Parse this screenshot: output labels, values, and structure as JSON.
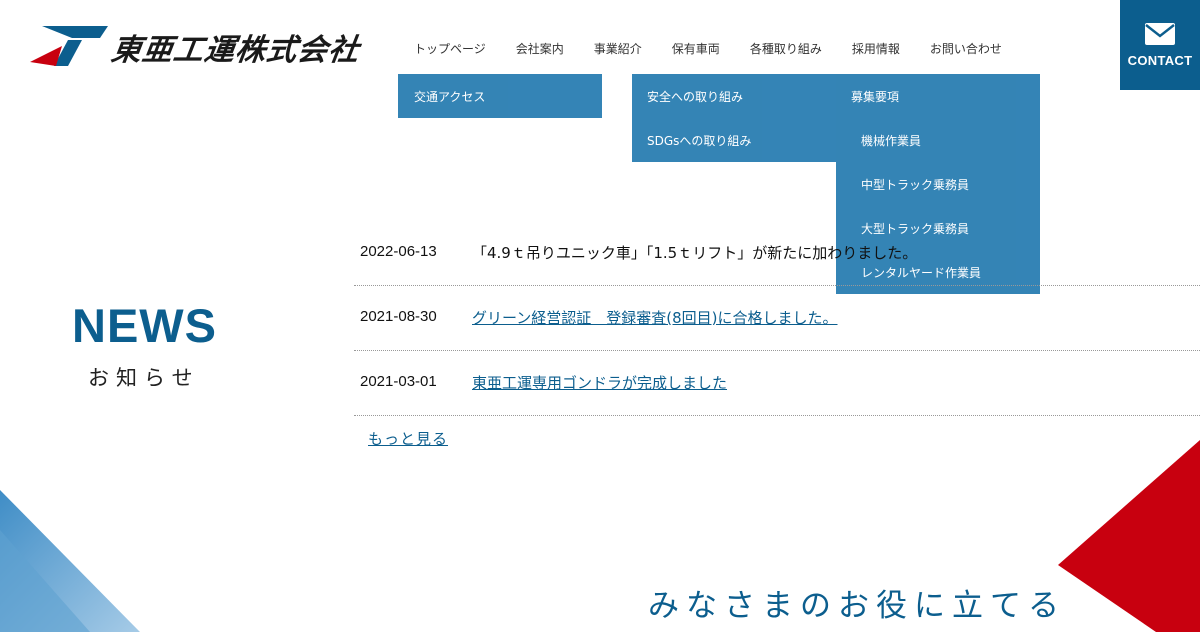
{
  "logo": {
    "company_name": "東亜工運株式会社"
  },
  "nav": {
    "items": [
      {
        "label": "トップページ",
        "name": "nav-top"
      },
      {
        "label": "会社案内",
        "name": "nav-company"
      },
      {
        "label": "事業紹介",
        "name": "nav-business"
      },
      {
        "label": "保有車両",
        "name": "nav-vehicles"
      },
      {
        "label": "各種取り組み",
        "name": "nav-initiatives"
      },
      {
        "label": "採用情報",
        "name": "nav-recruit"
      },
      {
        "label": "お問い合わせ",
        "name": "nav-inquiry"
      }
    ]
  },
  "contact": {
    "label": "CONTACT"
  },
  "dropdowns": {
    "company": [
      "交通アクセス"
    ],
    "initiatives": [
      "安全への取り組み",
      "SDGsへの取り組み"
    ],
    "recruit": [
      "募集要項",
      "機械作業員",
      "中型トラック乗務員",
      "大型トラック乗務員",
      "レンタルヤード作業員"
    ]
  },
  "news": {
    "title": "NEWS",
    "subtitle": "お知らせ",
    "items": [
      {
        "date": "2022-06-13",
        "text": "「4.9ｔ吊りユニック車」「1.5ｔリフト」が新たに加わりました。"
      },
      {
        "date": "2021-08-30",
        "text": "グリーン経営認証　登録審査(8回目)に合格しました。"
      },
      {
        "date": "2021-03-01",
        "text": "東亜工運専用ゴンドラが完成しました"
      }
    ],
    "more_label": "もっと見る"
  },
  "tagline": "みなさまのお役に立てる",
  "colors": {
    "brand_blue": "#0c5e8e",
    "dropdown_blue": "#2c7fb3",
    "brand_red": "#c8000f"
  }
}
